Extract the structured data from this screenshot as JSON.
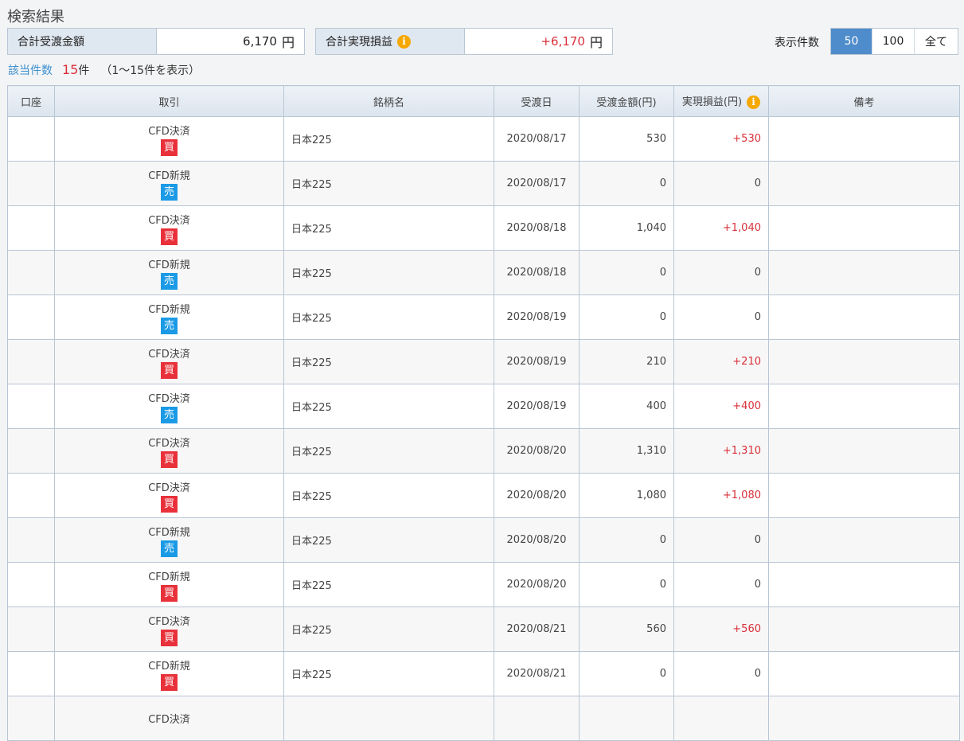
{
  "title": "検索結果",
  "summary": {
    "total_amount_label": "合計受渡金額",
    "total_amount": "6,170",
    "yen": "円",
    "total_pl_label": "合計実現損益",
    "total_pl": "+6,170"
  },
  "display": {
    "label": "表示件数",
    "options": [
      "50",
      "100",
      "全て"
    ],
    "selected": "50"
  },
  "hits": {
    "label": "該当件数",
    "count": "15",
    "unit": "件",
    "range": "（1〜15件を表示）"
  },
  "columns": [
    "口座",
    "取引",
    "銘柄名",
    "受渡日",
    "受渡金額(円)",
    "実現損益(円)",
    "備考"
  ],
  "rows": [
    {
      "account": "",
      "trade": "CFD決済",
      "side": "買",
      "name": "日本225",
      "date": "2020/08/17",
      "amount": "530",
      "pl": "+530",
      "note": ""
    },
    {
      "account": "",
      "trade": "CFD新規",
      "side": "売",
      "name": "日本225",
      "date": "2020/08/17",
      "amount": "0",
      "pl": "0",
      "note": ""
    },
    {
      "account": "",
      "trade": "CFD決済",
      "side": "買",
      "name": "日本225",
      "date": "2020/08/18",
      "amount": "1,040",
      "pl": "+1,040",
      "note": ""
    },
    {
      "account": "",
      "trade": "CFD新規",
      "side": "売",
      "name": "日本225",
      "date": "2020/08/18",
      "amount": "0",
      "pl": "0",
      "note": ""
    },
    {
      "account": "",
      "trade": "CFD新規",
      "side": "売",
      "name": "日本225",
      "date": "2020/08/19",
      "amount": "0",
      "pl": "0",
      "note": ""
    },
    {
      "account": "",
      "trade": "CFD決済",
      "side": "買",
      "name": "日本225",
      "date": "2020/08/19",
      "amount": "210",
      "pl": "+210",
      "note": ""
    },
    {
      "account": "",
      "trade": "CFD決済",
      "side": "売",
      "name": "日本225",
      "date": "2020/08/19",
      "amount": "400",
      "pl": "+400",
      "note": ""
    },
    {
      "account": "",
      "trade": "CFD決済",
      "side": "買",
      "name": "日本225",
      "date": "2020/08/20",
      "amount": "1,310",
      "pl": "+1,310",
      "note": ""
    },
    {
      "account": "",
      "trade": "CFD決済",
      "side": "買",
      "name": "日本225",
      "date": "2020/08/20",
      "amount": "1,080",
      "pl": "+1,080",
      "note": ""
    },
    {
      "account": "",
      "trade": "CFD新規",
      "side": "売",
      "name": "日本225",
      "date": "2020/08/20",
      "amount": "0",
      "pl": "0",
      "note": ""
    },
    {
      "account": "",
      "trade": "CFD新規",
      "side": "買",
      "name": "日本225",
      "date": "2020/08/20",
      "amount": "0",
      "pl": "0",
      "note": ""
    },
    {
      "account": "",
      "trade": "CFD決済",
      "side": "買",
      "name": "日本225",
      "date": "2020/08/21",
      "amount": "560",
      "pl": "+560",
      "note": ""
    },
    {
      "account": "",
      "trade": "CFD新規",
      "side": "買",
      "name": "日本225",
      "date": "2020/08/21",
      "amount": "0",
      "pl": "0",
      "note": ""
    },
    {
      "account": "",
      "trade": "CFD決済",
      "side": "",
      "name": "",
      "date": "",
      "amount": "",
      "pl": "",
      "note": ""
    }
  ]
}
